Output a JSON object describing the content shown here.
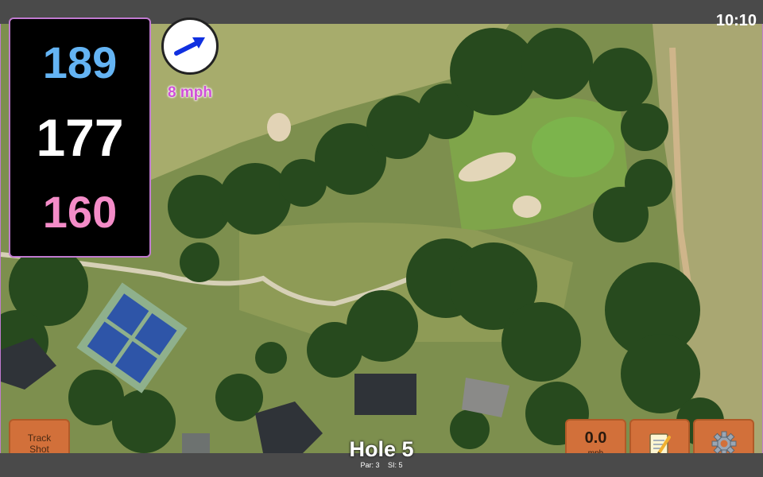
{
  "status": {
    "clock": "10:10"
  },
  "yardage": {
    "back": "189",
    "middle": "177",
    "front": "160"
  },
  "wind": {
    "speed_label": "8 mph",
    "icon": "wind-arrow-icon"
  },
  "hole": {
    "title": "Hole 5",
    "par": "Par: 3",
    "stroke_index": "SI: 5"
  },
  "buttons": {
    "track_shot": "Track Shot",
    "speed_value": "0.0",
    "speed_unit": "mph",
    "notes_icon": "notepad-icon",
    "settings_icon": "gear-icon"
  },
  "colors": {
    "back": "#64b4f4",
    "middle": "#ffffff",
    "front": "#f48cc8",
    "wind_label": "#d050d8",
    "button": "#d2703a"
  }
}
